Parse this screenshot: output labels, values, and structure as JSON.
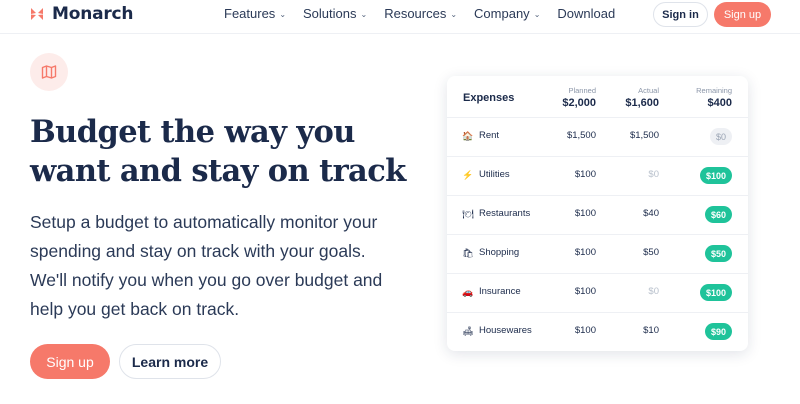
{
  "brand": {
    "name": "Monarch",
    "accent": "#f6796a",
    "green": "#1fc39a",
    "navy": "#1b2a4a"
  },
  "nav": {
    "items": [
      {
        "label": "Features",
        "dropdown": true
      },
      {
        "label": "Solutions",
        "dropdown": true
      },
      {
        "label": "Resources",
        "dropdown": true
      },
      {
        "label": "Company",
        "dropdown": true
      },
      {
        "label": "Download",
        "dropdown": false
      }
    ],
    "signin_label": "Sign in",
    "signup_label": "Sign up"
  },
  "hero": {
    "badge_icon": "map-icon",
    "headline": "Budget the way you want and stay on track",
    "description": "Setup a budget to automatically monitor your spending and stay on track with your goals. We'll notify you when you go over budget and help you get back on track.",
    "signup_label": "Sign up",
    "learn_label": "Learn more"
  },
  "budget": {
    "title": "Expenses",
    "columns": {
      "planned": {
        "label": "Planned",
        "total": "$2,000"
      },
      "actual": {
        "label": "Actual",
        "total": "$1,600"
      },
      "remaining": {
        "label": "Remaining",
        "total": "$400"
      }
    },
    "rows": [
      {
        "icon": "house-icon",
        "glyph": "🏠",
        "name": "Rent",
        "planned": "$1,500",
        "actual": "$1,500",
        "actual_zero": false,
        "remaining": "$0",
        "status": "gray"
      },
      {
        "icon": "lightning-icon",
        "glyph": "⚡",
        "name": "Utilities",
        "planned": "$100",
        "actual": "$0",
        "actual_zero": true,
        "remaining": "$100",
        "status": "green"
      },
      {
        "icon": "plate-icon",
        "glyph": "🍽",
        "name": "Restaurants",
        "planned": "$100",
        "actual": "$40",
        "actual_zero": false,
        "remaining": "$60",
        "status": "green"
      },
      {
        "icon": "shopping-bag-icon",
        "glyph": "🛍",
        "name": "Shopping",
        "planned": "$100",
        "actual": "$50",
        "actual_zero": false,
        "remaining": "$50",
        "status": "green"
      },
      {
        "icon": "car-icon",
        "glyph": "🚗",
        "name": "Insurance",
        "planned": "$100",
        "actual": "$0",
        "actual_zero": true,
        "remaining": "$100",
        "status": "green"
      },
      {
        "icon": "couch-icon",
        "glyph": "🛋",
        "name": "Housewares",
        "planned": "$100",
        "actual": "$10",
        "actual_zero": false,
        "remaining": "$90",
        "status": "green"
      }
    ]
  }
}
